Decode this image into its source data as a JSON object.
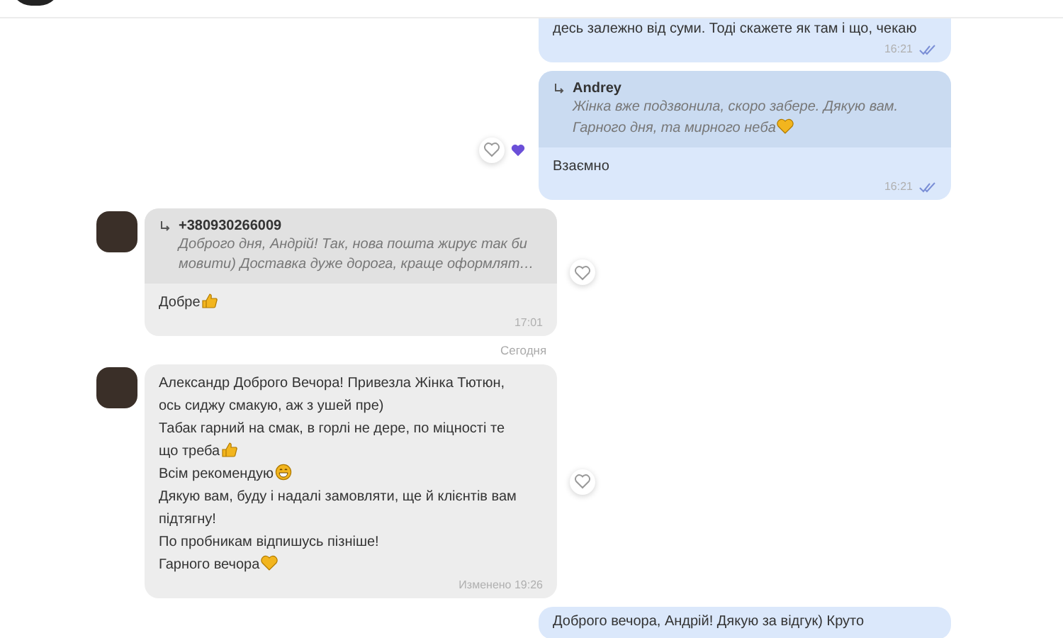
{
  "messages": [
    {
      "kind": "outgoing",
      "lines": [
        {
          "kind": "plain",
          "text": "десь залежно від суми. Тоді скажете як там і що, чекаю"
        }
      ],
      "time": "16:21",
      "read": true
    },
    {
      "kind": "outgoing",
      "reply": {
        "author": "Andrey",
        "lines": [
          {
            "kind": "plain",
            "text": "Жінка вже подзвонила, скоро забере. Дякую вам."
          },
          {
            "kind": "heart",
            "text": "Гарного дня, та мирного неба"
          }
        ]
      },
      "lines": [
        {
          "kind": "plain",
          "text": "Взаємно"
        }
      ],
      "time": "16:21",
      "read": true,
      "liked": true
    },
    {
      "kind": "incoming",
      "reply": {
        "author": "+380930266009",
        "lines": [
          {
            "kind": "plain",
            "text": "Доброго дня, Андрій! Так, нова пошта жирує так би"
          },
          {
            "kind": "plain",
            "text": "мовити) Доставка дуже дорога, краще оформлят…"
          }
        ]
      },
      "lines": [
        {
          "kind": "thumbs-up",
          "text": "Добре"
        }
      ],
      "time": "17:01",
      "liked": false
    },
    {
      "kind": "date",
      "label": "Сегодня"
    },
    {
      "kind": "incoming",
      "lines": [
        {
          "kind": "plain",
          "text": "Александр Доброго Вечора! Привезла Жінка Тютюн,"
        },
        {
          "kind": "plain",
          "text": "ось сиджу смакую, аж з ушей пре)"
        },
        {
          "kind": "plain",
          "text": "Табак гарний на смак, в горлі не дере, по міцності те"
        },
        {
          "kind": "thumbs-up",
          "text": "що треба"
        },
        {
          "kind": "grin",
          "text": "Всім рекомендую"
        },
        {
          "kind": "plain",
          "text": "Дякую вам, буду і надалі замовляти, ще й клієнтів вам"
        },
        {
          "kind": "plain",
          "text": "підтягну!"
        },
        {
          "kind": "plain",
          "text": "По пробникам відпишусь пізніше!"
        },
        {
          "kind": "heart",
          "text": "Гарного вечора"
        }
      ],
      "time": "Изменено 19:26",
      "liked": false
    },
    {
      "kind": "outgoing",
      "lines": [
        {
          "kind": "plain",
          "text": "Доброго вечора, Андрій! Дякую за відгук) Круто"
        }
      ]
    }
  ]
}
